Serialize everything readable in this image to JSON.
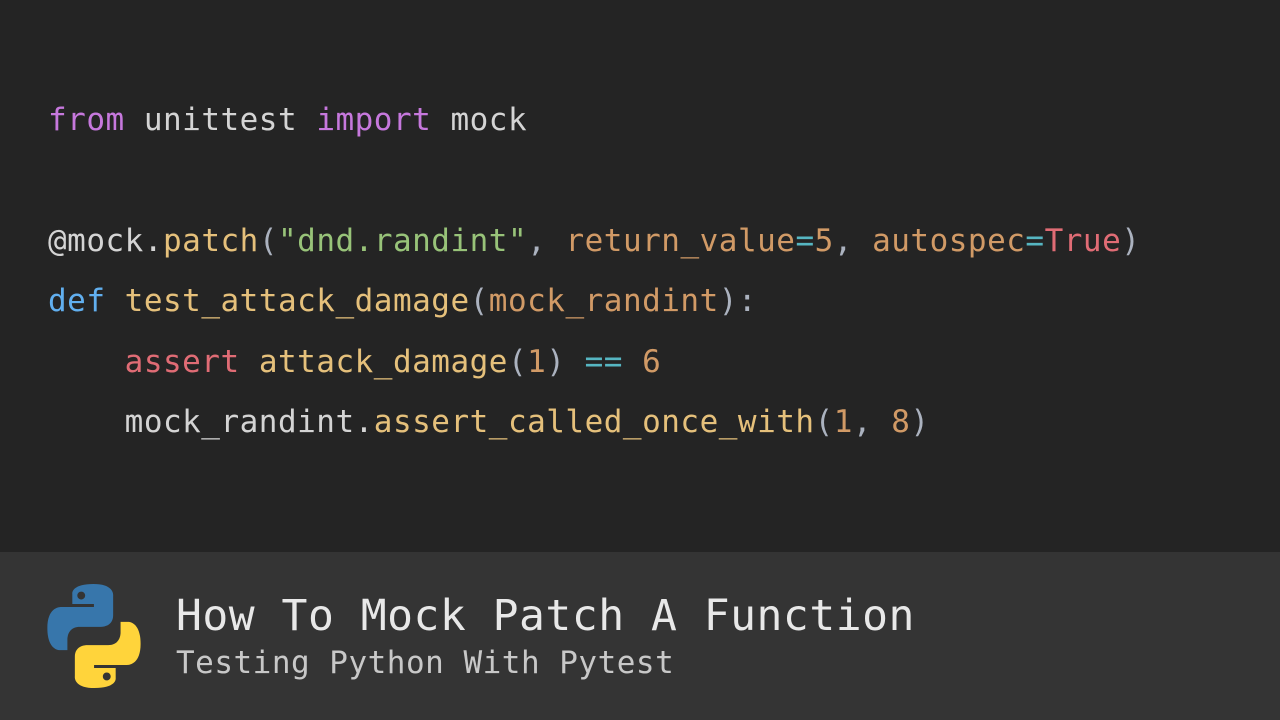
{
  "code": {
    "line1": {
      "from": "from",
      "module": "unittest",
      "import": "import",
      "name": "mock"
    },
    "line2": {
      "at": "@",
      "obj": "mock",
      "dot": ".",
      "method": "patch",
      "open": "(",
      "str": "\"dnd.randint\"",
      "comma1": ", ",
      "kw1": "return_value",
      "eq1": "=",
      "val1": "5",
      "comma2": ", ",
      "kw2": "autospec",
      "eq2": "=",
      "val2": "True",
      "close": ")"
    },
    "line3": {
      "def": "def",
      "space": " ",
      "fname": "test_attack_damage",
      "open": "(",
      "param": "mock_randint",
      "close": "):"
    },
    "line4": {
      "indent": "    ",
      "assert": "assert",
      "space": " ",
      "call": "attack_damage",
      "open": "(",
      "arg": "1",
      "close": ") ",
      "eq": "==",
      "space2": " ",
      "val": "6"
    },
    "line5": {
      "indent": "    ",
      "obj": "mock_randint",
      "dot": ".",
      "method": "assert_called_once_with",
      "open": "(",
      "arg1": "1",
      "comma": ", ",
      "arg2": "8",
      "close": ")"
    }
  },
  "footer": {
    "title": "How To Mock Patch A Function",
    "subtitle": "Testing Python With Pytest"
  }
}
